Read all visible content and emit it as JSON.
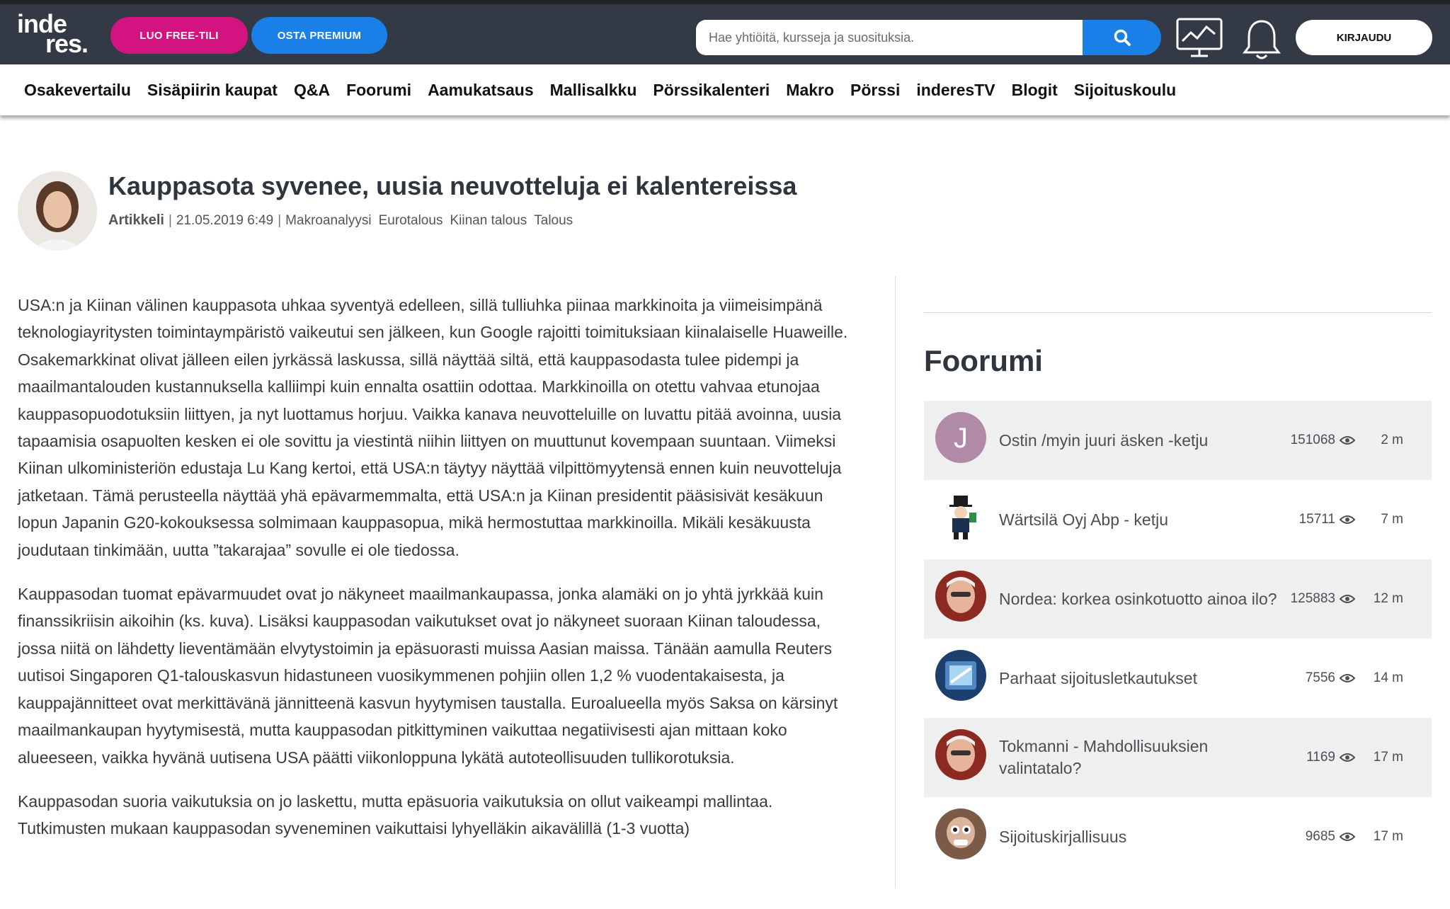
{
  "header": {
    "logo_line1": "inde",
    "logo_line2": "res.",
    "free_label": "LUO FREE-TILI",
    "premium_label": "OSTA PREMIUM",
    "search_placeholder": "Hae yhtiöitä, kursseja ja suosituksia.",
    "login_label": "KIRJAUDU",
    "colors": {
      "bar": "#333a45",
      "pink": "#d3137f",
      "blue": "#1a7fe6"
    }
  },
  "nav": [
    "Osakevertailu",
    "Sisäpiirin kaupat",
    "Q&A",
    "Foorumi",
    "Aamukatsaus",
    "Mallisalkku",
    "Pörssikalenteri",
    "Makro",
    "Pörssi",
    "inderesTV",
    "Blogit",
    "Sijoituskoulu"
  ],
  "article": {
    "title": "Kauppasota syvenee, uusia neuvotteluja ei kalentereissa",
    "type": "Artikkeli",
    "date": "21.05.2019 6:49",
    "tags": [
      "Makroanalyysi",
      "Eurotalous",
      "Kiinan talous",
      "Talous"
    ],
    "paragraphs": [
      "USA:n ja Kiinan välinen kauppasota uhkaa syventyä edelleen, sillä tulliuhka piinaa markkinoita ja viimeisimpänä teknologiayritysten toimintaympäristö vaikeutui sen jälkeen, kun Google rajoitti toimituksiaan kiinalaiselle Huaweille. Osakemarkkinat olivat jälleen eilen jyrkässä laskussa, sillä näyttää siltä, että kauppasodasta tulee pidempi ja maailmantalouden kustannuksella kalliimpi kuin ennalta osattiin odottaa. Markkinoilla on otettu vahvaa etunojaa kauppasopuodotuksiin liittyen, ja nyt luottamus horjuu. Vaikka kanava neuvotteluille on luvattu pitää avoinna, uusia tapaamisia osapuolten kesken ei ole sovittu ja viestintä niihin liittyen on muuttunut kovempaan suuntaan. Viimeksi Kiinan ulkoministeriön edustaja Lu Kang kertoi, että USA:n täytyy näyttää vilpittömyytensä ennen kuin neuvotteluja jatketaan. Tämä perusteella näyttää yhä epävarmemmalta, että USA:n ja Kiinan presidentit pääsisivät kesäkuun lopun Japanin G20-kokouksessa solmimaan kauppasopua, mikä hermostuttaa markkinoilla. Mikäli kesäkuusta joudutaan tinkimään, uutta ”takarajaa” sovulle ei ole tiedossa.",
      "Kauppasodan tuomat epävarmuudet ovat jo näkyneet maailmankaupassa, jonka alamäki on jo yhtä jyrkkää kuin finanssikriisin aikoihin (ks. kuva). Lisäksi kauppasodan vaikutukset ovat jo näkyneet suoraan Kiinan taloudessa, jossa niitä on lähdetty lieventämään elvytystoimin ja epäsuorasti muissa Aasian maissa. Tänään aamulla Reuters uutisoi Singaporen Q1-talouskasvun hidastuneen vuosikymmenen pohjiin ollen 1,2 % vuodentakaisesta, ja kauppajännitteet ovat merkittävänä jännitteenä kasvun hyytymisen taustalla. Euroalueella myös Saksa on kärsinyt maailmankaupan hyytymisestä, mutta kauppasodan pitkittyminen vaikuttaa negatiivisesti ajan mittaan koko alueeseen, vaikka hyvänä uutisena USA päätti viikonloppuna lykätä autoteollisuuden tullikorotuksia.",
      "Kauppasodan suoria vaikutuksia on jo laskettu, mutta epäsuoria vaikutuksia on ollut vaikeampi mallintaa. Tutkimusten mukaan kauppasodan syveneminen vaikuttaisi lyhyelläkin aikavälillä (1-3 vuotta)"
    ]
  },
  "forum": {
    "title": "Foorumi",
    "threads": [
      {
        "title": "Ostin /myin juuri äsken -ketju",
        "views": "151068",
        "time": "2 m",
        "avatar_letter": "J"
      },
      {
        "title": "Wärtsilä Oyj Abp - ketju",
        "views": "15711",
        "time": "7 m",
        "avatar_letter": ""
      },
      {
        "title": "Nordea: korkea osinkotuotto ainoa ilo?",
        "views": "125883",
        "time": "12 m",
        "avatar_letter": ""
      },
      {
        "title": "Parhaat sijoitusletkautukset",
        "views": "7556",
        "time": "14 m",
        "avatar_letter": ""
      },
      {
        "title": "Tokmanni - Mahdollisuuksien valintatalo?",
        "views": "1169",
        "time": "17 m",
        "avatar_letter": ""
      },
      {
        "title": "Sijoituskirjallisuus",
        "views": "9685",
        "time": "17 m",
        "avatar_letter": ""
      }
    ]
  }
}
